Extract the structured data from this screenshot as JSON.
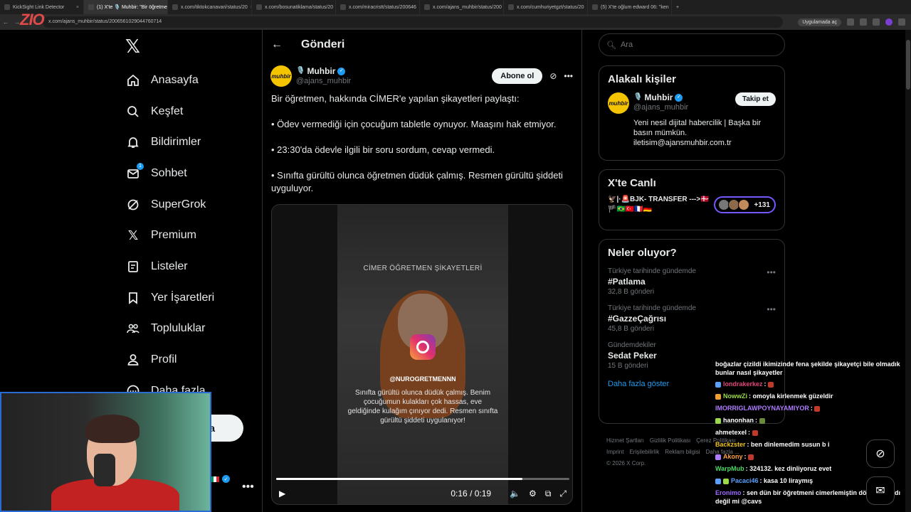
{
  "browser": {
    "tabs": [
      {
        "title": "KickSight Link Detector",
        "active": false
      },
      {
        "title": "(1) X'te 🎙️ Muhbir: \"Bir öğretmen",
        "active": true
      },
      {
        "title": "x.com/tiktokcanavari/status/20",
        "active": false
      },
      {
        "title": "x.com/bosunatiklama/status/20",
        "active": false
      },
      {
        "title": "x.com/miracristt/status/200646",
        "active": false
      },
      {
        "title": "x.com/ajans_muhbir/status/200",
        "active": false
      },
      {
        "title": "x.com/cumhuriyetgzt/status/20",
        "active": false
      },
      {
        "title": "(5) X'te oğlum edward 06: \"ken",
        "active": false
      }
    ],
    "url": "x.com/ajans_muhbir/status/2006561029044760714",
    "app_pill": "Uygulamada aç"
  },
  "overlay_logo": "ZIO",
  "nav": {
    "items": [
      {
        "label": "Anasayfa",
        "icon": "home-icon"
      },
      {
        "label": "Keşfet",
        "icon": "search-icon"
      },
      {
        "label": "Bildirimler",
        "icon": "bell-icon"
      },
      {
        "label": "Sohbet",
        "icon": "mail-icon",
        "badge": "1"
      },
      {
        "label": "SuperGrok",
        "icon": "grok-icon"
      },
      {
        "label": "Premium",
        "icon": "x-icon"
      },
      {
        "label": "Listeler",
        "icon": "list-icon"
      },
      {
        "label": "Yer İşaretleri",
        "icon": "bookmark-icon"
      },
      {
        "label": "Topluluklar",
        "icon": "people-icon"
      },
      {
        "label": "Profil",
        "icon": "person-icon"
      },
      {
        "label": "Daha fazla",
        "icon": "more-circle-icon"
      }
    ],
    "post_button_partial": "a"
  },
  "main": {
    "title": "Gönderi",
    "author": {
      "name": "Muhbir",
      "handle": "@ajans_muhbir",
      "avatar_text": "muhbir",
      "follow_label": "Abone ol"
    },
    "text": [
      "Bir öğretmen, hakkında CİMER'e yapılan şikayetleri paylaştı:",
      "• Ödev vermediği için çocuğum tabletle oynuyor. Maaşını hak etmiyor.",
      "•  23:30'da ödevle ilgili bir soru sordum, cevap vermedi.",
      "•  Sınıfta gürültü olunca öğretmen düdük çalmış. Resmen gürültü şiddeti uyguluyor."
    ],
    "video": {
      "caption_top": "CİMER ÖĞRETMEN ŞİKAYETLERİ",
      "user": "@NUROGRETMENNN",
      "subtitle": "Sınıfta gürültü olunca düdük çalmış. Benim çocuğumun kulakları çok hassas, eve geldiğinde kulağım çınıyor dedi. Resmen sınıfta gürültü şiddeti uygulanıyor!",
      "time": "0:16 / 0:19",
      "progress": 0.84
    }
  },
  "sidebar": {
    "search_placeholder": "Ara",
    "related": {
      "title": "Alakalı kişiler",
      "name": "Muhbir",
      "handle": "@ajans_muhbir",
      "follow_label": "Takip et",
      "bio": "Yeni nesil dijital habercilik | Başka bir basın mümkün. iletisim@ajansmuhbir.com.tr"
    },
    "live": {
      "title": "X'te Canlı",
      "text": "🦅|·🚨BJK- TRANSFER --->🇩🇰🏴🇧🇷🇹🇷🇫🇷🇩🇪",
      "count": "+131"
    },
    "trends": {
      "title": "Neler oluyor?",
      "items": [
        {
          "context": "Türkiye tarihinde gündemde",
          "name": "#Patlama",
          "count": "32,8 B gönderi"
        },
        {
          "context": "Türkiye tarihinde gündemde",
          "name": "#GazzeÇağrısı",
          "count": "45,8 B gönderi"
        },
        {
          "context": "Gündemdekiler",
          "name": "Sedat Peker",
          "count": "15 B gönderi"
        }
      ],
      "show_more": "Daha fazla göster"
    },
    "footer": [
      "Hizmet Şartları",
      "Gizlilik Politikası",
      "Çerez Politikası",
      "Imprint",
      "Erişilebilirlik",
      "Reklam bilgisi",
      "Daha fazla ...",
      "© 2026 X Corp."
    ]
  },
  "chat": [
    {
      "user": "",
      "msg": "boğazlar çizildi ikimizinde fena şekilde şikayetçi bile olmadık bunlar nasıl şikayetler",
      "color": "#ffffff",
      "wrap": true
    },
    {
      "user": "londrakerkez",
      "msg": ":",
      "color": "#e0467a",
      "emote": true
    },
    {
      "user": "NowwZi",
      "msg": ": omoyla kirlenmek güzeldir",
      "color": "#9ad94a"
    },
    {
      "user": "IMORRIGLAWPOYNAYAMIYOR",
      "msg": ":",
      "color": "#b07cff",
      "emote": true
    },
    {
      "user": "hanonhan",
      "msg": ":",
      "color": "#ffffff",
      "emote": true
    },
    {
      "user": "ahmetexel",
      "msg": ":",
      "color": "#ffffff",
      "emote": true
    },
    {
      "user": "Backzster",
      "msg": ": ben dinlemedim susun b i",
      "color": "#f0c419"
    },
    {
      "user": "Akony",
      "msg": ":",
      "color": "#ff9f43",
      "emote": true
    },
    {
      "user": "WarpMub",
      "msg": ": 324132. kez dinliyoruz evet",
      "color": "#4cd964"
    },
    {
      "user": "Pacaci46",
      "msg": ": kasa 10 liraymış",
      "color": "#5aa0ff"
    },
    {
      "user": "Eronimo",
      "msg": ": sen dün bir öğretmeni cimerlemiştin dönüş olmadı değil mi @cavs",
      "color": "#9b6bff",
      "wrap": true
    }
  ],
  "colors": {
    "accent": "#1d9bf0",
    "bg": "#000000",
    "border": "#2f3336",
    "muted": "#71767b"
  }
}
